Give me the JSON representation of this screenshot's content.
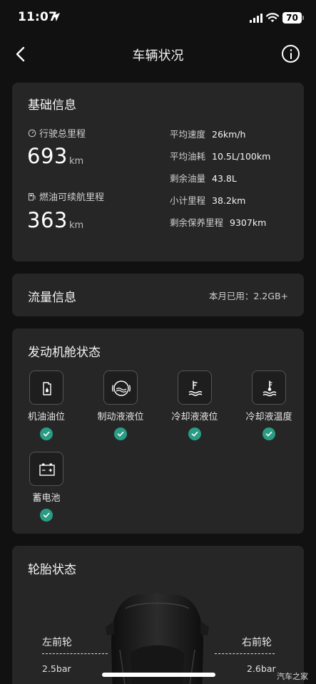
{
  "status_bar": {
    "time": "11:07",
    "battery": "70"
  },
  "nav": {
    "title": "车辆状况"
  },
  "basic_info": {
    "title": "基础信息",
    "total_mileage": {
      "label": "行驶总里程",
      "value": "693",
      "unit": "km"
    },
    "fuel_range": {
      "label": "燃油可续航里程",
      "value": "363",
      "unit": "km"
    },
    "stats": [
      {
        "key": "平均速度",
        "value": "26km/h"
      },
      {
        "key": "平均油耗",
        "value": "10.5L/100km"
      },
      {
        "key": "剩余油量",
        "value": "43.8L"
      },
      {
        "key": "小计里程",
        "value": "38.2km"
      },
      {
        "key": "剩余保养里程",
        "value": "9307km"
      }
    ]
  },
  "traffic": {
    "title": "流量信息",
    "usage": "本月已用：2.2GB+"
  },
  "engine": {
    "title": "发动机舱状态",
    "items": [
      {
        "label": "机油油位",
        "icon": "oil-can-icon",
        "status": "ok"
      },
      {
        "label": "制动液液位",
        "icon": "brake-fluid-icon",
        "status": "ok"
      },
      {
        "label": "冷却液液位",
        "icon": "coolant-level-icon",
        "status": "ok"
      },
      {
        "label": "冷却液温度",
        "icon": "coolant-temperature-icon",
        "status": "ok"
      },
      {
        "label": "蓄电池",
        "icon": "battery-icon",
        "status": "ok"
      }
    ]
  },
  "tire": {
    "title": "轮胎状态",
    "front_left": {
      "label": "左前轮",
      "pressure": "2.5bar"
    },
    "front_right": {
      "label": "右前轮",
      "pressure": "2.6bar"
    }
  },
  "watermark": "汽车之家",
  "colors": {
    "background": "#111111",
    "card": "#262626",
    "ok_green": "#2a9c85"
  }
}
